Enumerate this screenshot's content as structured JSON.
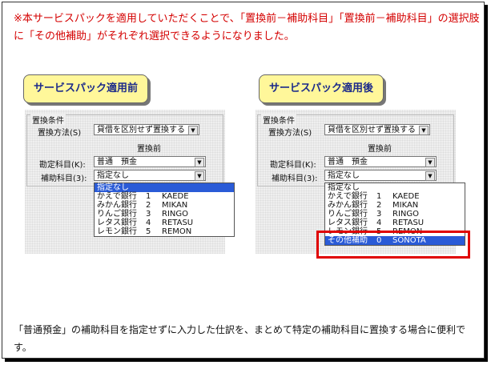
{
  "note": "※本サービスパックを適用していただくことで、「置換前－補助科目」「置換前－補助科目」の選択肢に「その他補助」がそれぞれ選択できるようになりました。",
  "bottom_text": "「普通預金」の補助科目を指定せずに入力した仕訳を、まとめて特定の補助科目に置換する場合に便利です。",
  "before": {
    "tag": "サービスパック適用前",
    "group_title": "置換条件",
    "method_label": "置換方法(S)",
    "method_value": "貸借を区別せず置換する",
    "col_header": "置換前",
    "account_label": "勘定科目(K):",
    "account_value": "普通　預金",
    "sub_label": "補助科目(3):",
    "sub_value": "指定なし",
    "options": [
      {
        "name": "指定なし",
        "code": "",
        "kana": ""
      },
      {
        "name": "かえで銀行",
        "code": "1",
        "kana": "KAEDE"
      },
      {
        "name": "みかん銀行",
        "code": "2",
        "kana": "MIKAN"
      },
      {
        "name": "りんご銀行",
        "code": "3",
        "kana": "RINGO"
      },
      {
        "name": "レタス銀行",
        "code": "4",
        "kana": "RETASU"
      },
      {
        "name": "レモン銀行",
        "code": "5",
        "kana": "REMON"
      }
    ]
  },
  "after": {
    "tag": "サービスパック適用後",
    "group_title": "置換条件",
    "method_label": "置換方法(S)",
    "method_value": "貸借を区別せず置換する",
    "col_header": "置換前",
    "account_label": "勘定科目(K):",
    "account_value": "普通　預金",
    "sub_label": "補助科目(3):",
    "sub_value": "指定なし",
    "options": [
      {
        "name": "指定なし",
        "code": "",
        "kana": ""
      },
      {
        "name": "かえで銀行",
        "code": "1",
        "kana": "KAEDE"
      },
      {
        "name": "みかん銀行",
        "code": "2",
        "kana": "MIKAN"
      },
      {
        "name": "りんご銀行",
        "code": "3",
        "kana": "RINGO"
      },
      {
        "name": "レタス銀行",
        "code": "4",
        "kana": "RETASU"
      },
      {
        "name": "レモン銀行",
        "code": "5",
        "kana": "REMON"
      },
      {
        "name": "その他補助",
        "code": "0",
        "kana": "SONOTA"
      }
    ]
  },
  "colors": {
    "accent_red": "#e00000",
    "highlight_blue": "#2a5bd7",
    "tag_yellow": "#fff79a"
  }
}
